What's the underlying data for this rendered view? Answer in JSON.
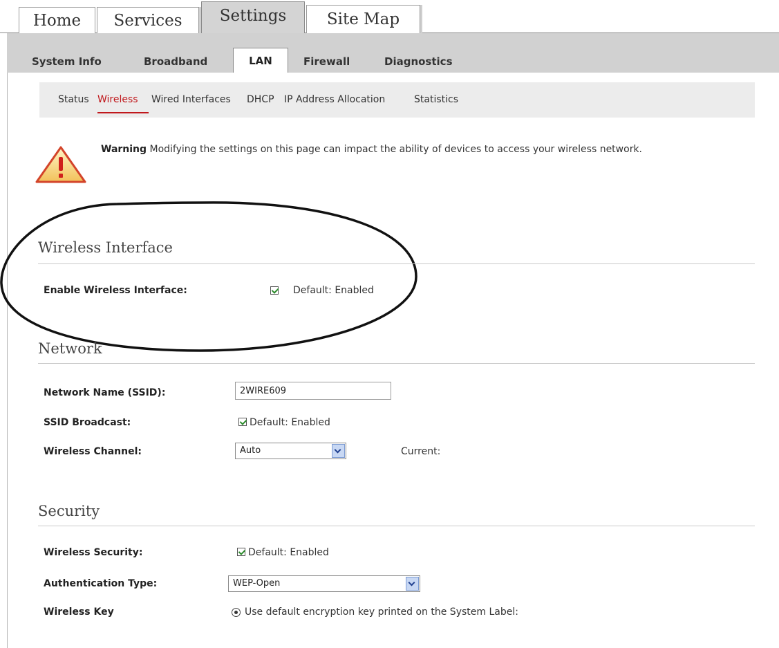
{
  "top_tabs": [
    "Home",
    "Services",
    "Settings",
    "Site Map"
  ],
  "top_tabs_active": "Settings",
  "sub_tabs": [
    "System Info",
    "Broadband",
    "LAN",
    "Firewall",
    "Diagnostics"
  ],
  "sub_tabs_active": "LAN",
  "section_links": [
    "Status",
    "Wireless",
    "Wired Interfaces",
    "DHCP",
    "IP Address Allocation",
    "Statistics"
  ],
  "section_links_active": "Wireless",
  "warning": {
    "icon": "warning-triangle-icon",
    "title": "Warning",
    "text": "Modifying the settings on this page can impact the ability of devices to access your wireless network."
  },
  "wireless_interface": {
    "title": "Wireless Interface",
    "enable_label": "Enable Wireless Interface:",
    "enable_checked": true,
    "enable_default": "Default: Enabled"
  },
  "network": {
    "title": "Network",
    "ssid_label": "Network Name (SSID):",
    "ssid_value": "2WIRE609",
    "broadcast_label": "SSID Broadcast:",
    "broadcast_checked": true,
    "broadcast_default": "Default: Enabled",
    "channel_label": "Wireless Channel:",
    "channel_value": "Auto",
    "channel_current": "Current:"
  },
  "security": {
    "title": "Security",
    "wireless_security_label": "Wireless Security:",
    "wireless_security_checked": true,
    "wireless_security_default": "Default: Enabled",
    "auth_label": "Authentication Type:",
    "auth_value": "WEP-Open",
    "key_label": "Wireless Key",
    "key_option": "Use default encryption key printed on the System Label:"
  },
  "colors": {
    "active_link": "#c0181c",
    "tab_bar": "#d1d1d1",
    "link_bar": "#ececec",
    "check": "#2a8a2a"
  }
}
